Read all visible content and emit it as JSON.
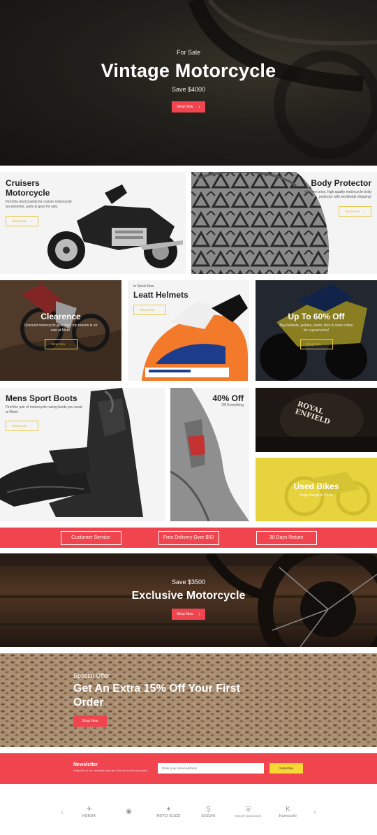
{
  "hero": {
    "eyebrow": "For Sale",
    "title": "Vintage Motorcycle",
    "subtitle": "Save $4000",
    "button_label": "Shop Now"
  },
  "tiles": {
    "cruisers": {
      "title": "Cruisers Motorcycle",
      "description": "Find the best brands for cruiser motorcycle accessories, parts & gear for sale.",
      "button_label": "Shop Now"
    },
    "body_protector": {
      "title": "Body Protector",
      "description": "Buy low price, high quality motorcycle body protector with worldwide shipping!",
      "button_label": "Shop Now"
    },
    "clearence": {
      "title": "Clearence",
      "description": "Discount motorcycle gear from top brands is on sale at Moto.",
      "button_label": "Shop Now"
    },
    "leatt": {
      "eyebrow": "In Stock Now",
      "title": "Leatt Helmets",
      "button_label": "Shop Now"
    },
    "upto": {
      "title": "Up To 60% Off",
      "description": "Buy helmets, jackets, pants, tires & more online for a great price!",
      "button_label": "Shop Now"
    },
    "boots": {
      "title": "Mens Sport Boots",
      "description": "Find the pair of motorcycle racing boots you need at Moto!",
      "button_label": "Shop Now"
    },
    "gloves": {
      "title": "40% Off",
      "subtitle": "Off Everything"
    },
    "royal": {
      "logo_line1": "ROYAL",
      "logo_line2": "ENFIELD"
    },
    "used": {
      "title": "Used Bikes",
      "subtitle": "Huge Range In Stock"
    }
  },
  "services": {
    "items": [
      "Customer Service",
      "Free Delivery Over $50",
      "30 Days Return"
    ]
  },
  "exclusive": {
    "eyebrow": "Save $3500",
    "title": "Exclusive Motorcycle",
    "button_label": "Shop Now"
  },
  "special": {
    "eyebrow": "Special Offer",
    "title": "Get An Extra 15% Off Your First Order",
    "button_label": "Shop Now"
  },
  "newsletter": {
    "title": "Newsletter",
    "subtitle": "Subscribe to our newsletter and get 10% off your first purchase",
    "placeholder": "Enter your email address",
    "button_label": "Subscribe"
  },
  "brands": {
    "prev_icon": "chevron-left-icon",
    "next_icon": "chevron-right-icon",
    "logos": [
      {
        "name": "HONDA",
        "mark": "✈"
      },
      {
        "name": "",
        "mark": "◉"
      },
      {
        "name": "MOTO GUZZI",
        "mark": "✦"
      },
      {
        "name": "SUZUKI",
        "mark": "Ş"
      },
      {
        "name": "HARLEY-DAVIDSON",
        "mark": "⛨"
      },
      {
        "name": "Kawasaki",
        "mark": "K"
      }
    ]
  },
  "colors": {
    "accent_red": "#f0454f",
    "accent_yellow": "#e7c94a",
    "used_bikes_bg": "#e2d03a",
    "subscribe_bg": "#f8d734"
  }
}
